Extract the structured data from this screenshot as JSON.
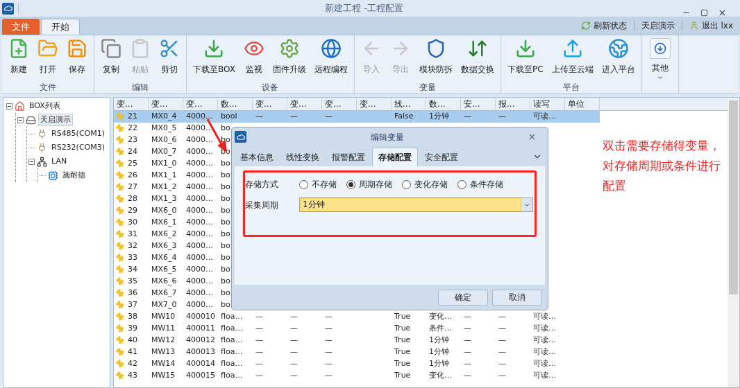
{
  "window": {
    "title": "新建工程 -工程配置"
  },
  "ribbon_tabs": [
    {
      "label": "文件",
      "kind": "file",
      "selected": false
    },
    {
      "label": "开始",
      "kind": "tab",
      "selected": true
    }
  ],
  "top_links": [
    {
      "label": "刷新状态",
      "kind": "refresh"
    },
    {
      "label": "天启演示",
      "kind": "plain"
    },
    {
      "label": "退出 lxx",
      "kind": "user"
    }
  ],
  "ribbon_groups": [
    {
      "label": "文件",
      "items": [
        {
          "label": "新建",
          "kind": "new",
          "disabled": false
        },
        {
          "label": "打开",
          "kind": "open",
          "disabled": false
        },
        {
          "label": "保存",
          "kind": "save",
          "disabled": false
        }
      ]
    },
    {
      "label": "编辑",
      "items": [
        {
          "label": "复制",
          "kind": "copy",
          "disabled": false
        },
        {
          "label": "粘贴",
          "kind": "paste",
          "disabled": true
        },
        {
          "label": "剪切",
          "kind": "cut",
          "disabled": false
        }
      ]
    },
    {
      "label": "设备",
      "items": [
        {
          "label": "下载至BOX",
          "kind": "download",
          "disabled": false
        },
        {
          "label": "监视",
          "kind": "eye",
          "disabled": false
        },
        {
          "label": "固件升级",
          "kind": "gear",
          "disabled": false
        },
        {
          "label": "远程编程",
          "kind": "globe",
          "disabled": false
        }
      ]
    },
    {
      "label": "变量",
      "items": [
        {
          "label": "导入",
          "kind": "import",
          "disabled": true
        },
        {
          "label": "导出",
          "kind": "export",
          "disabled": true
        },
        {
          "label": "模块防拆",
          "kind": "shield",
          "disabled": false
        },
        {
          "label": "数据交换",
          "kind": "exchange",
          "disabled": false
        }
      ]
    },
    {
      "label": "平台",
      "items": [
        {
          "label": "下载至PC",
          "kind": "download",
          "disabled": false
        },
        {
          "label": "上传至云端",
          "kind": "upload",
          "disabled": false
        },
        {
          "label": "进入平台",
          "kind": "earth",
          "disabled": false
        }
      ]
    },
    {
      "items": [
        {
          "label": "其他",
          "kind": "more",
          "disabled": false
        }
      ]
    }
  ],
  "tree": [
    {
      "label": "BOX列表",
      "kind": "home",
      "expanded": true,
      "selected": false,
      "children": [
        {
          "label": "天启演示",
          "kind": "device",
          "expanded": true,
          "selected": true,
          "children": [
            {
              "label": "RS485(COM1)",
              "kind": "port",
              "selected": false
            },
            {
              "label": "RS232(COM3)",
              "kind": "port",
              "selected": false
            },
            {
              "label": "LAN",
              "kind": "lan",
              "expanded": true,
              "selected": false,
              "children": [
                {
                  "label": "施耐德",
                  "kind": "plc",
                  "selected": false
                }
              ]
            }
          ]
        }
      ]
    }
  ],
  "table": {
    "columns": [
      "变...",
      "变...",
      "变...",
      "数...",
      "变...",
      "变...",
      "变...",
      "变...",
      "线...",
      "数...",
      "安...",
      "报...",
      "读写",
      "单位"
    ],
    "rows": [
      {
        "selected": true,
        "cells": [
          "21",
          "MX0_4",
          "4000…",
          "bool",
          "—",
          "—",
          "—",
          null,
          "False",
          "1分钟",
          "—",
          "—",
          "可读…"
        ]
      },
      {
        "selected": false,
        "cells": [
          "22",
          "MX0_5",
          "4000…",
          "bo"
        ]
      },
      {
        "selected": false,
        "cells": [
          "23",
          "MX0_6",
          "4000…",
          "bo"
        ]
      },
      {
        "selected": false,
        "cells": [
          "24",
          "MX0_7",
          "4000…",
          "bo"
        ]
      },
      {
        "selected": false,
        "cells": [
          "25",
          "MX1_0",
          "4000…",
          "bo"
        ]
      },
      {
        "selected": false,
        "cells": [
          "26",
          "MX1_1",
          "4000…",
          "bo"
        ]
      },
      {
        "selected": false,
        "cells": [
          "27",
          "MX1_2",
          "4000…",
          "bo"
        ]
      },
      {
        "selected": false,
        "cells": [
          "28",
          "MX1_3",
          "4000…",
          "bo"
        ]
      },
      {
        "selected": false,
        "cells": [
          "29",
          "MX6_0",
          "4000…",
          "bo"
        ]
      },
      {
        "selected": false,
        "cells": [
          "30",
          "MX6_1",
          "4000…",
          "bo"
        ]
      },
      {
        "selected": false,
        "cells": [
          "31",
          "MX6_2",
          "4000…",
          "bo"
        ]
      },
      {
        "selected": false,
        "cells": [
          "32",
          "MX6_3",
          "4000…",
          "bo"
        ]
      },
      {
        "selected": false,
        "cells": [
          "33",
          "MX6_4",
          "4000…",
          "bo"
        ]
      },
      {
        "selected": false,
        "cells": [
          "34",
          "MX6_5",
          "4000…",
          "bo"
        ]
      },
      {
        "selected": false,
        "cells": [
          "35",
          "MX6_6",
          "4000…",
          "bo"
        ]
      },
      {
        "selected": false,
        "cells": [
          "36",
          "MX6_7",
          "4000…",
          "bo"
        ]
      },
      {
        "selected": false,
        "cells": [
          "37",
          "MX7_0",
          "4000…",
          "bo"
        ]
      },
      {
        "selected": false,
        "cells": [
          "38",
          "MW10",
          "400010",
          "floa…",
          "—",
          "—",
          "—",
          null,
          "True",
          "变化…",
          "—",
          "—",
          "可读…"
        ]
      },
      {
        "selected": false,
        "cells": [
          "39",
          "MW11",
          "400011",
          "floa…",
          "—",
          "—",
          "—",
          null,
          "True",
          "条件…",
          "—",
          "—",
          "可读…"
        ]
      },
      {
        "selected": false,
        "cells": [
          "40",
          "MW12",
          "400012",
          "floa…",
          "—",
          "—",
          "—",
          null,
          "True",
          "1分钟",
          "—",
          "—",
          "可读…"
        ]
      },
      {
        "selected": false,
        "cells": [
          "41",
          "MW13",
          "400013",
          "floa…",
          "—",
          "—",
          "—",
          null,
          "True",
          "1分钟",
          "—",
          "—",
          "可读…"
        ]
      },
      {
        "selected": false,
        "cells": [
          "42",
          "MW14",
          "400014",
          "floa…",
          "—",
          "—",
          "—",
          null,
          "True",
          "1分钟",
          "—",
          "—",
          "可读…"
        ]
      },
      {
        "selected": false,
        "cells": [
          "43",
          "MW15",
          "400015",
          "floa…",
          "—",
          "—",
          "—",
          null,
          "True",
          "变化…",
          "—",
          "—",
          "可读…"
        ]
      }
    ]
  },
  "dialog": {
    "title": "编辑变量",
    "tabs": [
      {
        "label": "基本信息",
        "selected": false
      },
      {
        "label": "线性变换",
        "selected": false
      },
      {
        "label": "报警配置",
        "selected": false
      },
      {
        "label": "存储配置",
        "selected": true
      },
      {
        "label": "安全配置",
        "selected": false
      }
    ],
    "storage_mode": {
      "label": "存储方式",
      "options": [
        {
          "label": "不存储",
          "selected": false
        },
        {
          "label": "周期存储",
          "selected": true
        },
        {
          "label": "变化存储",
          "selected": false
        },
        {
          "label": "条件存储",
          "selected": false
        }
      ]
    },
    "period": {
      "label": "采集周期",
      "value": "1分钟"
    },
    "buttons": [
      "确定",
      "取消"
    ]
  },
  "annotation": "双击需要存储得变量，对存储周期或条件进行配置"
}
